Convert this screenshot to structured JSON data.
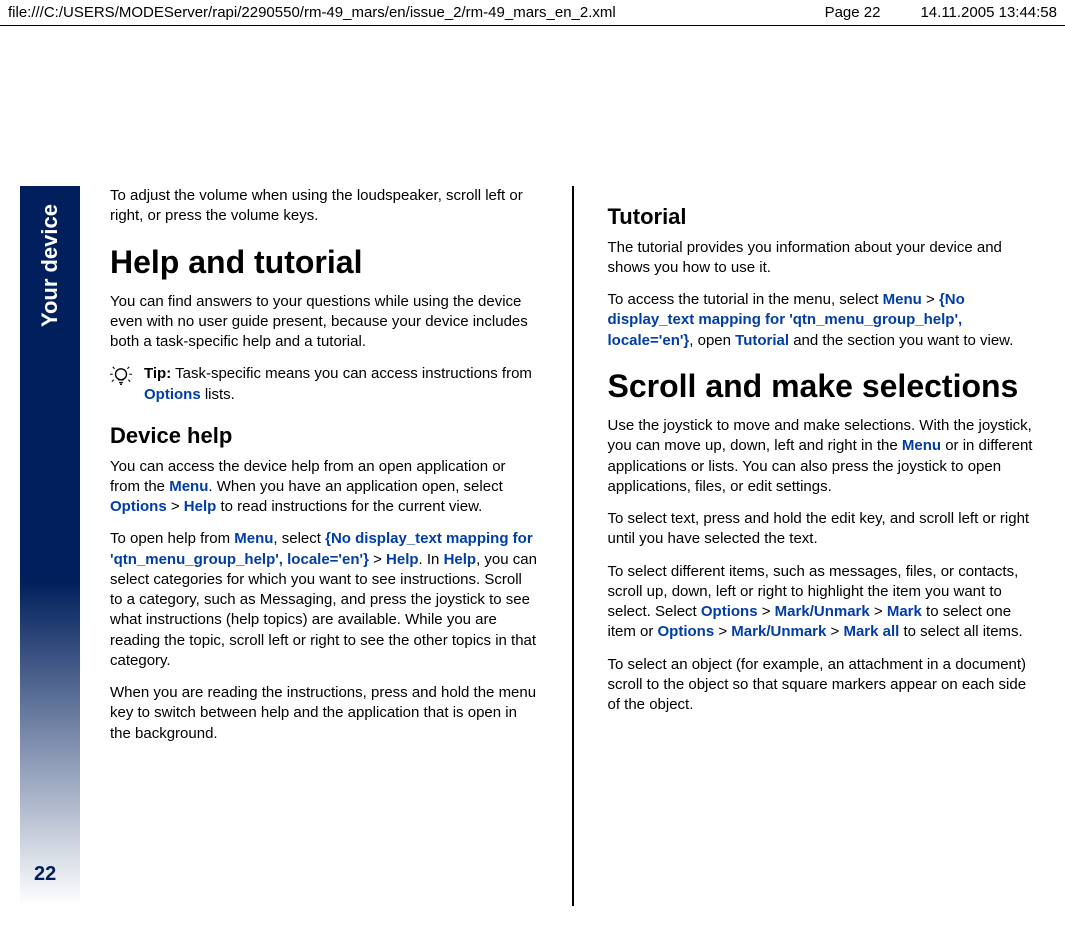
{
  "header": {
    "path": "file:///C:/USERS/MODEServer/rapi/2290550/rm-49_mars/en/issue_2/rm-49_mars_en_2.xml",
    "page": "Page 22",
    "timestamp": "14.11.2005 13:44:58"
  },
  "sidebar": {
    "label": "Your device",
    "page_num": "22"
  },
  "left": {
    "p0": "To adjust the volume when using the loudspeaker, scroll left or right, or press the volume keys.",
    "h1": "Help and tutorial",
    "p1": "You can find answers to your questions while using the device even with no user guide present, because your device includes both a task-specific help and a tutorial.",
    "tip": {
      "label": "Tip:",
      "t1": "Task-specific means you can access instructions from",
      "options": "Options",
      "t2": "lists."
    },
    "h2": "Device help",
    "p2a": "You can access the device help from an open application or from the",
    "menu": "Menu",
    "p2b": ". When you have an application open, select",
    "options": "Options",
    "gt": ">",
    "help": "Help",
    "p2c": "to read instructions for the current view.",
    "p3a": "To open help from",
    "p3b": ", select",
    "no_display": "{No display_text mapping for 'qtn_menu_group_help', locale='en'}",
    "p3c": ". In",
    "p3d": ", you can select categories for which you want to see instructions. Scroll to a category, such as Messaging, and press the joystick to see what instructions (help topics) are available. While you are reading the topic, scroll left or right to see the other topics in that category.",
    "p4": "When you are reading the instructions, press and hold the menu key to switch between help and the application that is open in the background."
  },
  "right": {
    "h2a": "Tutorial",
    "p0": "The tutorial provides you information about your device and shows you how to use it.",
    "p1a": "To access the tutorial in the menu, select",
    "menu": "Menu",
    "gt": ">",
    "no_display": "{No display_text mapping for 'qtn_menu_group_help', locale='en'}",
    "p1b": ", open",
    "tutorial": "Tutorial",
    "p1c": "and the section you want to view.",
    "h1": "Scroll and make selections",
    "p2a": "Use the joystick to move and make selections. With the joystick, you can move up, down, left and right in the",
    "p2b": "or in different applications or lists. You can also press the joystick to open applications, files, or edit settings.",
    "p3": "To select text, press and hold the edit key, and scroll left or right until you have selected the text.",
    "p4a": "To select different items, such as messages, files, or contacts, scroll up, down, left or right to highlight the item you want to select. Select",
    "options": "Options",
    "mark_unmark": "Mark/Unmark",
    "mark": "Mark",
    "p4b": "to select one item or",
    "mark_all": "Mark all",
    "p4c": "to select all items.",
    "p5": "To select an object (for example, an attachment in a document) scroll to the object so that square markers appear on each side of the object."
  }
}
